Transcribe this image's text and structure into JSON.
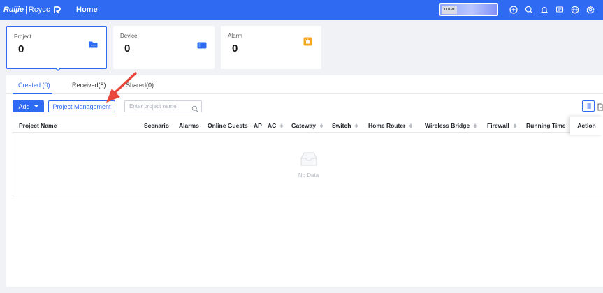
{
  "header": {
    "brand_primary": "Ruijie",
    "brand_secondary": "Rcycc",
    "home_tab": "Home",
    "org_logo_text": "LOGO"
  },
  "cards": [
    {
      "label": "Project",
      "value": "0",
      "icon": "folder-icon",
      "color": "#2f6bf2"
    },
    {
      "label": "Device",
      "value": "0",
      "icon": "device-icon",
      "color": "#2f6bf2"
    },
    {
      "label": "Alarm",
      "value": "0",
      "icon": "alarm-icon",
      "color": "#f5a623"
    }
  ],
  "tabs": [
    {
      "label": "Created (0)",
      "active": true
    },
    {
      "label": "Received(8)",
      "active": false
    },
    {
      "label": "Shared(0)",
      "active": false
    }
  ],
  "toolbar": {
    "add_label": "Add",
    "project_management_label": "Project Management",
    "search_placeholder": "Enter project name"
  },
  "table": {
    "columns": [
      {
        "label": "Project Name",
        "sortable": false
      },
      {
        "label": "Scenario",
        "sortable": false
      },
      {
        "label": "Alarms",
        "sortable": false
      },
      {
        "label": "Online Guests",
        "sortable": false
      },
      {
        "label": "AP",
        "sortable": false
      },
      {
        "label": "AC",
        "sortable": true
      },
      {
        "label": "Gateway",
        "sortable": true
      },
      {
        "label": "Switch",
        "sortable": true
      },
      {
        "label": "Home Router",
        "sortable": true
      },
      {
        "label": "Wireless Bridge",
        "sortable": true
      },
      {
        "label": "Firewall",
        "sortable": true
      },
      {
        "label": "Running Time",
        "sortable": false
      }
    ],
    "action_label": "Action",
    "empty_text": "No Data"
  },
  "colors": {
    "primary": "#2f6bf2",
    "alarm": "#f5a623",
    "annotation": "#e8473b"
  }
}
